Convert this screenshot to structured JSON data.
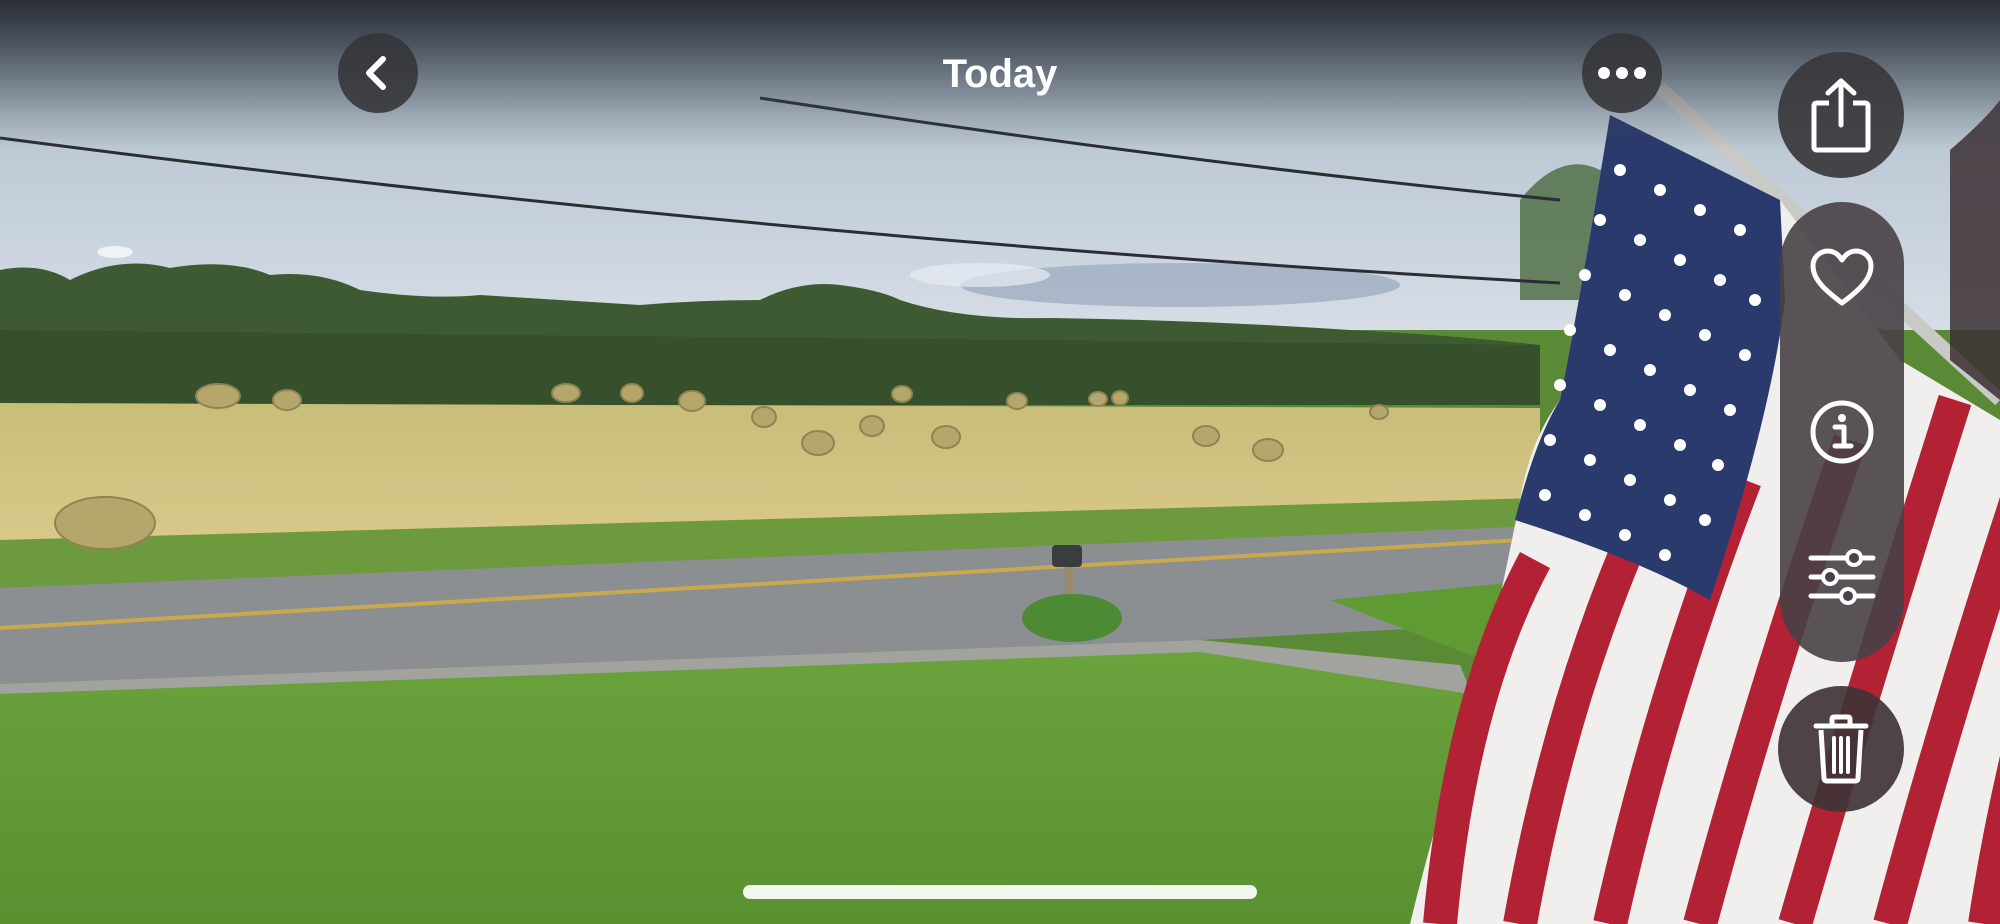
{
  "header": {
    "title": "Today"
  },
  "buttons": {
    "back_icon": "chevron-left-icon",
    "more_icon": "ellipsis-icon",
    "share_icon": "share-icon",
    "favorite_icon": "heart-icon",
    "info_icon": "info-icon",
    "adjust_icon": "sliders-icon",
    "delete_icon": "trash-icon"
  },
  "colors": {
    "button_bg": "#343438",
    "icon": "#ffffff"
  }
}
